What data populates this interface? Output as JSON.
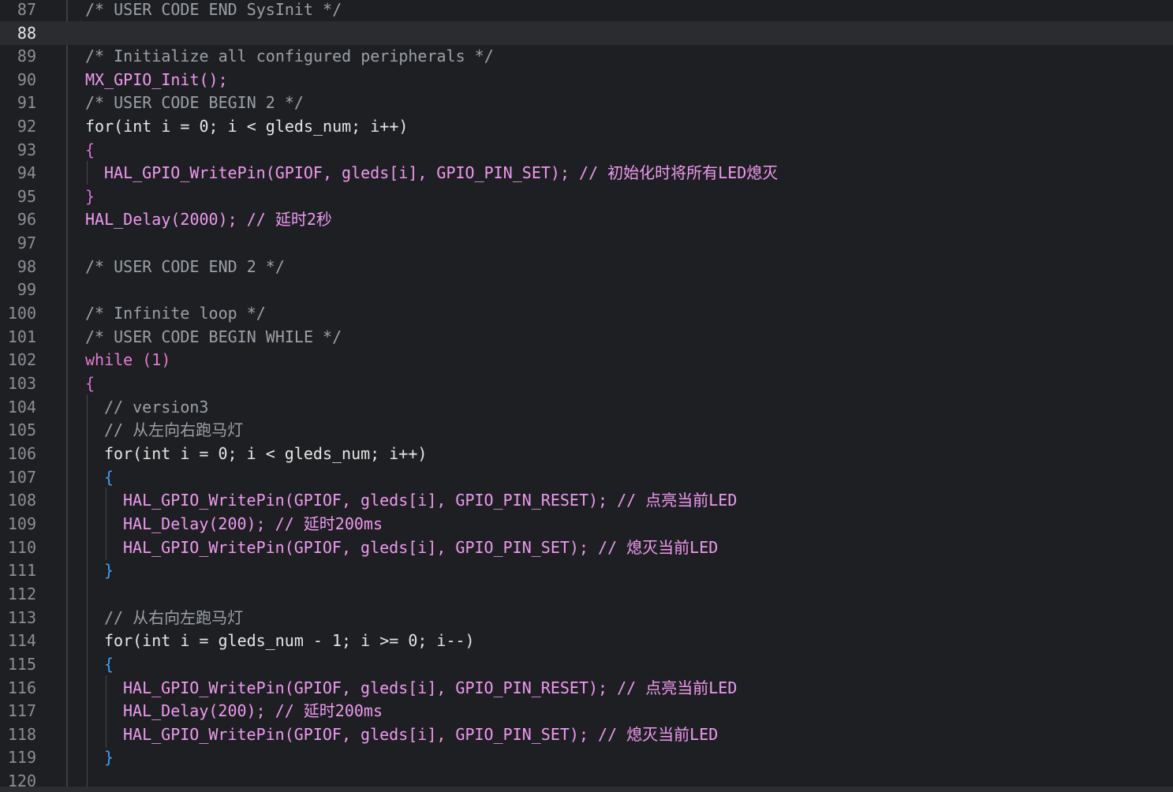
{
  "editor": {
    "current_line": "88",
    "lines": [
      {
        "n": "87",
        "text": "/* USER CODE END SysInit */"
      },
      {
        "n": "88",
        "text": ""
      },
      {
        "n": "89",
        "text": "/* Initialize all configured peripherals */"
      },
      {
        "n": "90",
        "text": "MX_GPIO_Init();"
      },
      {
        "n": "91",
        "text": "/* USER CODE BEGIN 2 */"
      },
      {
        "n": "92",
        "text": "for(int i = 0; i < gleds_num; i++)"
      },
      {
        "n": "93",
        "text": "{"
      },
      {
        "n": "94",
        "text": "HAL_GPIO_WritePin(GPIOF, gleds[i], GPIO_PIN_SET); // 初始化时将所有LED熄灭"
      },
      {
        "n": "95",
        "text": "}"
      },
      {
        "n": "96",
        "text": "HAL_Delay(2000); // 延时2秒"
      },
      {
        "n": "97",
        "text": ""
      },
      {
        "n": "98",
        "text": "/* USER CODE END 2 */"
      },
      {
        "n": "99",
        "text": ""
      },
      {
        "n": "100",
        "text": "/* Infinite loop */"
      },
      {
        "n": "101",
        "text": "/* USER CODE BEGIN WHILE */"
      },
      {
        "n": "102",
        "text": "while (1)"
      },
      {
        "n": "103",
        "text": "{"
      },
      {
        "n": "104",
        "text": "// version3"
      },
      {
        "n": "105",
        "text": "// 从左向右跑马灯"
      },
      {
        "n": "106",
        "text": "for(int i = 0; i < gleds_num; i++)"
      },
      {
        "n": "107",
        "text": "{"
      },
      {
        "n": "108",
        "text": "HAL_GPIO_WritePin(GPIOF, gleds[i], GPIO_PIN_RESET); // 点亮当前LED"
      },
      {
        "n": "109",
        "text": "HAL_Delay(200); // 延时200ms"
      },
      {
        "n": "110",
        "text": "HAL_GPIO_WritePin(GPIOF, gleds[i], GPIO_PIN_SET); // 熄灭当前LED"
      },
      {
        "n": "111",
        "text": "}"
      },
      {
        "n": "112",
        "text": ""
      },
      {
        "n": "113",
        "text": "// 从右向左跑马灯"
      },
      {
        "n": "114",
        "text": "for(int i = gleds_num - 1; i >= 0; i--)"
      },
      {
        "n": "115",
        "text": "{"
      },
      {
        "n": "116",
        "text": "HAL_GPIO_WritePin(GPIOF, gleds[i], GPIO_PIN_RESET); // 点亮当前LED"
      },
      {
        "n": "117",
        "text": "HAL_Delay(200); // 延时200ms"
      },
      {
        "n": "118",
        "text": "HAL_GPIO_WritePin(GPIOF, gleds[i], GPIO_PIN_SET); // 熄灭当前LED"
      },
      {
        "n": "119",
        "text": "}"
      },
      {
        "n": "120",
        "text": ""
      }
    ]
  },
  "colors": {
    "background": "#1e1f22",
    "current_line": "#2a2c30",
    "comment": "#9aa0a8",
    "keyword": "#e57bd0",
    "type": "#f08c5a",
    "function": "#ee99f0",
    "number": "#b8e08a",
    "constant": "#62aef5",
    "bracket_level1": "#f2c744",
    "bracket_level2": "#da70d6",
    "bracket_level3": "#3aa0ff"
  }
}
